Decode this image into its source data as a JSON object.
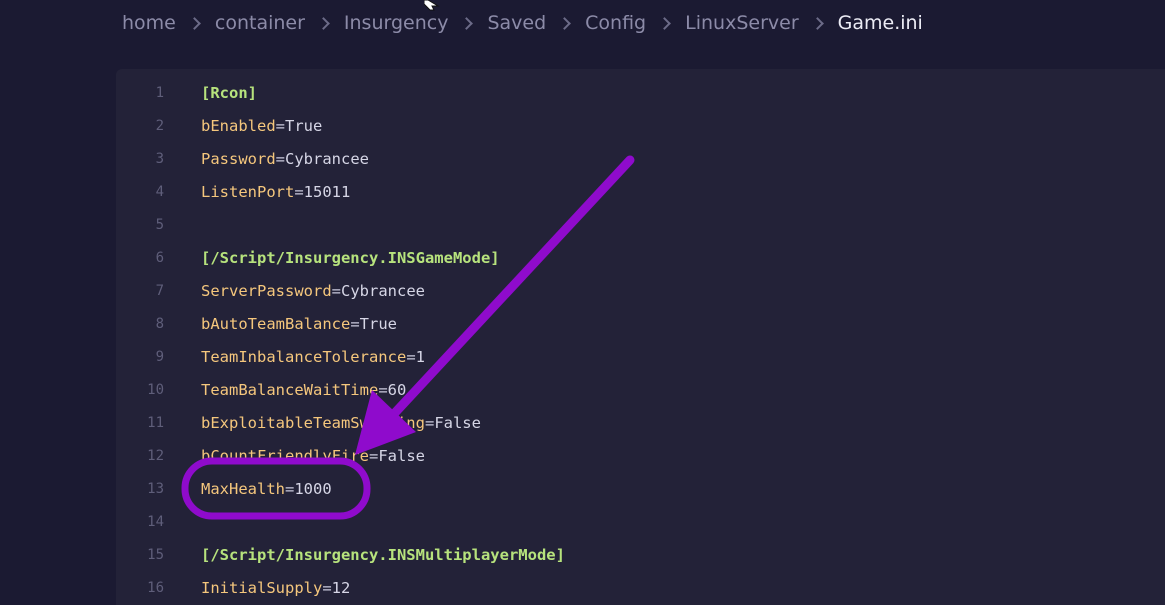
{
  "breadcrumb": {
    "items": [
      "home",
      "container",
      "Insurgency",
      "Saved",
      "Config",
      "LinuxServer"
    ],
    "current": "Game.ini"
  },
  "editor": {
    "lines": [
      {
        "num": "1",
        "type": "section",
        "text": "[Rcon]"
      },
      {
        "num": "2",
        "type": "kv",
        "key": "bEnabled",
        "value": "True"
      },
      {
        "num": "3",
        "type": "kv",
        "key": "Password",
        "value": "Cybrancee"
      },
      {
        "num": "4",
        "type": "kv",
        "key": "ListenPort",
        "value": "15011"
      },
      {
        "num": "5",
        "type": "blank"
      },
      {
        "num": "6",
        "type": "section",
        "text": "[/Script/Insurgency.INSGameMode]"
      },
      {
        "num": "7",
        "type": "kv",
        "key": "ServerPassword",
        "value": "Cybrancee"
      },
      {
        "num": "8",
        "type": "kv",
        "key": "bAutoTeamBalance",
        "value": "True"
      },
      {
        "num": "9",
        "type": "kv",
        "key": "TeamInbalanceTolerance",
        "value": "1"
      },
      {
        "num": "10",
        "type": "kv",
        "key": "TeamBalanceWaitTime",
        "value": "60"
      },
      {
        "num": "11",
        "type": "kv",
        "key": "bExploitableTeamSwapping",
        "value": "False"
      },
      {
        "num": "12",
        "type": "kv",
        "key": "bCountFriendlyFire",
        "value": "False"
      },
      {
        "num": "13",
        "type": "kv",
        "key": "MaxHealth",
        "value": "1000"
      },
      {
        "num": "14",
        "type": "blank"
      },
      {
        "num": "15",
        "type": "section",
        "text": "[/Script/Insurgency.INSMultiplayerMode]"
      },
      {
        "num": "16",
        "type": "kv",
        "key": "InitialSupply",
        "value": "12"
      }
    ]
  },
  "annotation": {
    "color": "#8f0bcc"
  }
}
